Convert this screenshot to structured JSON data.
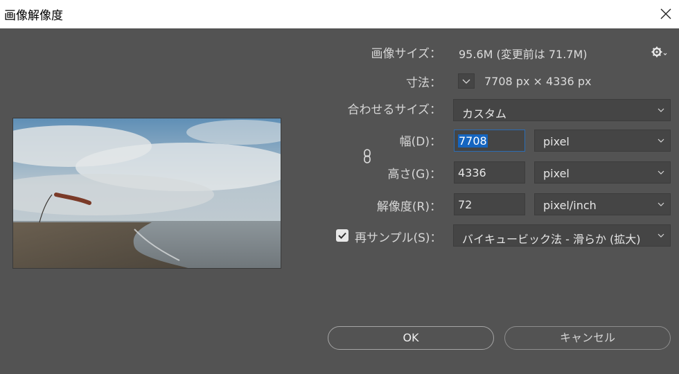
{
  "window": {
    "title": "画像解像度"
  },
  "info": {
    "image_size_label": "画像サイズ：",
    "image_size_value": "95.6M (変更前は 71.7M)",
    "dimensions_label": "寸法：",
    "dimensions_value": "7708 px × 4336 px"
  },
  "fit_to": {
    "label": "合わせるサイズ：",
    "value": "カスタム"
  },
  "width": {
    "label": "幅(D)：",
    "value": "7708",
    "unit": "pixel"
  },
  "height": {
    "label": "高さ(G)：",
    "value": "4336",
    "unit": "pixel"
  },
  "resolution": {
    "label": "解像度(R)：",
    "value": "72",
    "unit": "pixel/inch"
  },
  "resample": {
    "label": "再サンプル(S)：",
    "checked": true,
    "method": "バイキュービック法 - 滑らか (拡大)"
  },
  "buttons": {
    "ok": "OK",
    "cancel": "キャンセル"
  },
  "icons": {
    "settings": "gear-icon",
    "link": "chain-link-icon",
    "close": "close-icon"
  },
  "colors": {
    "dialog_bg": "#535353",
    "field_bg": "#454545",
    "selection": "#1565c0",
    "focus_border": "#2b6cb3"
  }
}
